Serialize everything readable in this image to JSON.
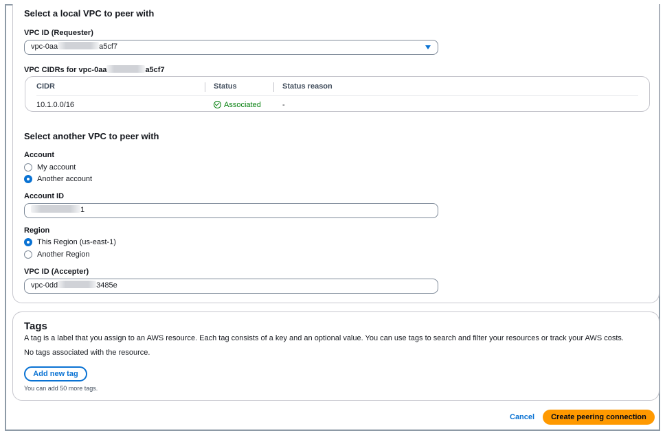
{
  "local": {
    "heading": "Select a local VPC to peer with",
    "vpc_label": "VPC ID (Requester)",
    "vpc_prefix": "vpc-0aa",
    "vpc_suffix": "a5cf7",
    "cidrs_label_prefix": "VPC CIDRs for vpc-0aa",
    "cidrs_label_suffix": "a5cf7",
    "table": {
      "columns": [
        "CIDR",
        "Status",
        "Status reason"
      ],
      "rows": [
        {
          "cidr": "10.1.0.0/16",
          "status": "Associated",
          "reason": "-"
        }
      ]
    }
  },
  "other": {
    "heading": "Select another VPC to peer with",
    "account_label": "Account",
    "account_options": [
      "My account",
      "Another account"
    ],
    "account_selected": "Another account",
    "account_id_label": "Account ID",
    "account_id_suffix": "1",
    "region_label": "Region",
    "region_options": [
      "This Region (us-east-1)",
      "Another Region"
    ],
    "region_selected": "This Region (us-east-1)",
    "accepter_label": "VPC ID (Accepter)",
    "accepter_prefix": "vpc-0dd",
    "accepter_suffix": "3485e"
  },
  "tags": {
    "title": "Tags",
    "description": "A tag is a label that you assign to an AWS resource. Each tag consists of a key and an optional value. You can use tags to search and filter your resources or track your AWS costs.",
    "empty": "No tags associated with the resource.",
    "add_button": "Add new tag",
    "limit_note": "You can add 50 more tags."
  },
  "footer": {
    "cancel": "Cancel",
    "submit": "Create peering connection"
  },
  "colors": {
    "accent": "#0972d3",
    "primary_button": "#ff9900",
    "success": "#037f0c"
  },
  "icons": [
    "caret-down-icon",
    "status-success-icon"
  ]
}
